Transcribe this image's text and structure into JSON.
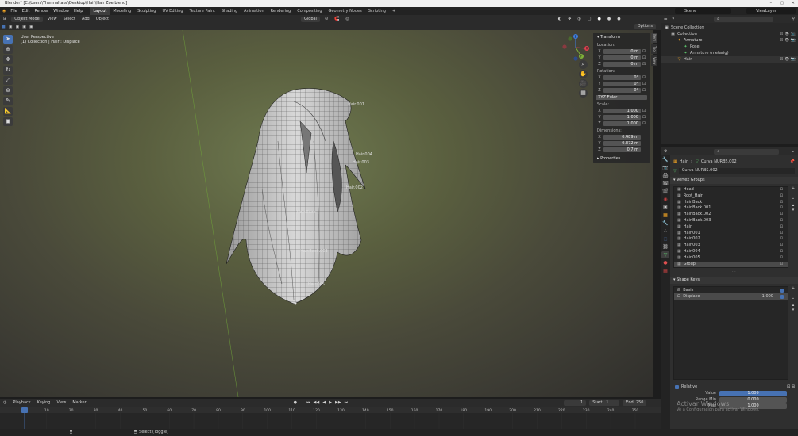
{
  "window": {
    "title": "Blender* [C:\\Users\\Thermaltake\\Desktop\\Hair\\Hair Zoe.blend]",
    "controls": [
      "–",
      "□",
      "✕"
    ]
  },
  "topbar": {
    "menu": [
      "File",
      "Edit",
      "Render",
      "Window",
      "Help"
    ],
    "workspaces": [
      "Layout",
      "Modeling",
      "Sculpting",
      "UV Editing",
      "Texture Paint",
      "Shading",
      "Animation",
      "Rendering",
      "Compositing",
      "Geometry Nodes",
      "Scripting"
    ],
    "active_workspace": "Layout",
    "add_tab": "+",
    "scene": "Scene",
    "view_layer": "ViewLayer"
  },
  "viewport_header": {
    "mode": "Object Mode",
    "menus": [
      "View",
      "Select",
      "Add",
      "Object"
    ],
    "orientation": "Global",
    "options": "Options"
  },
  "viewport": {
    "info_line1": "User Perspective",
    "info_line2": "(1) Collection | Hair : Displace",
    "labels": [
      "Hair.001",
      "Hair.004",
      "Hair.003",
      "Hair.002",
      "Hair.005",
      "Hair.Back",
      "Hair.Back.003"
    ]
  },
  "toolbar_icons": [
    "cursor-select",
    "cursor-3d",
    "move",
    "rotate",
    "scale",
    "transform",
    "annotate",
    "measure",
    "add-cube"
  ],
  "npanel": {
    "header": "Transform",
    "location_label": "Location:",
    "location": [
      {
        "axis": "X",
        "value": "0 m"
      },
      {
        "axis": "Y",
        "value": "0 m"
      },
      {
        "axis": "Z",
        "value": "0 m"
      }
    ],
    "rotation_label": "Rotation:",
    "rotation": [
      {
        "axis": "X",
        "value": "0°"
      },
      {
        "axis": "Y",
        "value": "0°"
      },
      {
        "axis": "Z",
        "value": "0°"
      }
    ],
    "rotation_mode": "XYZ Euler",
    "scale_label": "Scale:",
    "scale": [
      {
        "axis": "X",
        "value": "1.000"
      },
      {
        "axis": "Y",
        "value": "1.000"
      },
      {
        "axis": "Z",
        "value": "1.000"
      }
    ],
    "dimensions_label": "Dimensions:",
    "dimensions": [
      {
        "axis": "X",
        "value": "0.489 m"
      },
      {
        "axis": "Y",
        "value": "0.372 m"
      },
      {
        "axis": "Z",
        "value": "0.7 m"
      }
    ],
    "properties": "Properties",
    "tabs": [
      "Item",
      "Tool",
      "View"
    ]
  },
  "gizmo": {
    "x": "X",
    "y": "Y",
    "z": "Z"
  },
  "timeline": {
    "menus": [
      "Playback",
      "Keying",
      "View",
      "Marker"
    ],
    "current_frame": "1",
    "start_label": "Start",
    "start": "1",
    "end_label": "End",
    "end": "250",
    "ticks": [
      "1",
      "10",
      "20",
      "30",
      "40",
      "50",
      "60",
      "70",
      "80",
      "90",
      "100",
      "110",
      "120",
      "130",
      "140",
      "150",
      "160",
      "170",
      "180",
      "190",
      "200",
      "210",
      "220",
      "230",
      "240",
      "250"
    ]
  },
  "statusbar": {
    "select": "Select (Toggle)",
    "version": ""
  },
  "outliner": {
    "rows": [
      {
        "label": "Scene Collection",
        "indent": 0,
        "icon": "▣"
      },
      {
        "label": "Collection",
        "indent": 1,
        "icon": "▣"
      },
      {
        "label": "Armature",
        "indent": 2,
        "icon": "✦"
      },
      {
        "label": "Pose",
        "indent": 3,
        "icon": "✦"
      },
      {
        "label": "Armature (metarig)",
        "indent": 3,
        "icon": "✦"
      },
      {
        "label": "Hair",
        "indent": 2,
        "icon": "▽"
      }
    ]
  },
  "properties": {
    "breadcrumb_object": "Hair",
    "breadcrumb_data": "Curva NURBS.002",
    "data_name": "Curva NURBS.002",
    "vertex_groups_title": "Vertex Groups",
    "vertex_groups": [
      "Head",
      "Root_Hair",
      "Hair.Back",
      "Hair.Back.001",
      "Hair.Back.002",
      "Hair.Back.003",
      "Hair",
      "Hair.001",
      "Hair.002",
      "Hair.003",
      "Hair.004",
      "Hair.005",
      "Group"
    ],
    "selected_group": "Group",
    "shape_keys_title": "Shape Keys",
    "shape_keys": [
      {
        "name": "Basis",
        "value": ""
      },
      {
        "name": "Displace",
        "value": "1.000"
      }
    ],
    "relative_label": "Relative",
    "value_label": "Value",
    "value": "1.000",
    "range_min_label": "Range Min",
    "range_min": "0.000",
    "max_label": "Max",
    "max": "1.000"
  },
  "watermark": {
    "line1": "Activar Windows",
    "line2": "Ve a Configuración para activar Windows."
  },
  "colors": {
    "accent": "#4772b3",
    "active_orange": "#f5a623"
  }
}
